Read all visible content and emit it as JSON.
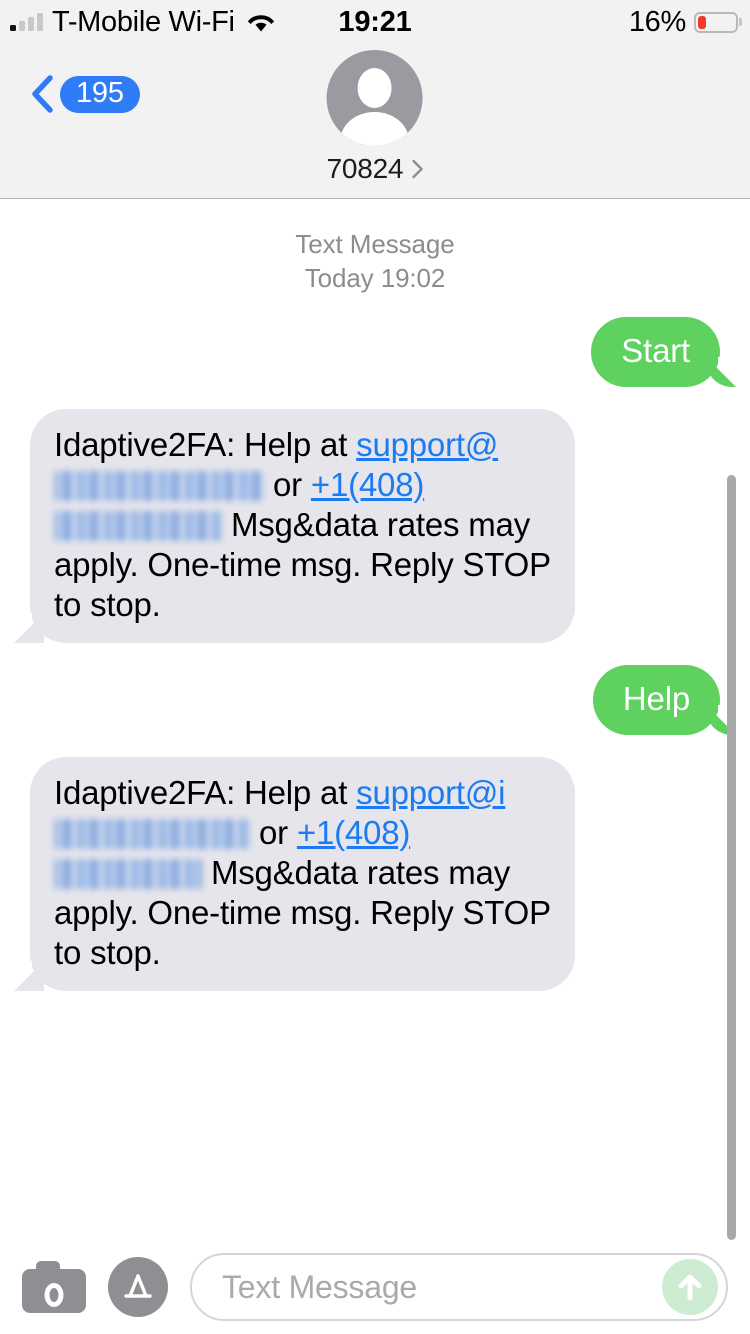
{
  "status_bar": {
    "carrier": "T-Mobile Wi-Fi",
    "time": "19:21",
    "battery_percent": "16%",
    "battery_level": 16,
    "signal_bars_filled": 1,
    "signal_bars_total": 4,
    "wifi_icon": "wifi-icon",
    "battery_icon": "battery-icon",
    "battery_color": "#f03b2d"
  },
  "nav_bar": {
    "back_badge": "195",
    "back_icon": "chevron-left-icon",
    "badge_color": "#2f7cf6",
    "contact_name": "70824",
    "contact_chevron_icon": "chevron-right-icon",
    "avatar_icon": "person-avatar-icon"
  },
  "conversation": {
    "service_label": "Text Message",
    "timestamp": "Today 19:02",
    "outgoing_color": "#5ed15e",
    "incoming_color": "#e6e5eb",
    "link_color": "#1a7bf2",
    "messages": [
      {
        "id": "msg-1",
        "direction": "outgoing",
        "text": "Start"
      },
      {
        "id": "msg-2",
        "direction": "incoming",
        "segments": {
          "lead": "Idaptive2FA: Help at ",
          "email_visible": "support@",
          "email_redacted": true,
          "between": " or ",
          "phone_visible": "+1(408)",
          "phone_redacted": true,
          "tail": " Msg&data rates may apply. One-time msg. Reply STOP to stop."
        }
      },
      {
        "id": "msg-3",
        "direction": "outgoing",
        "text": "Help"
      },
      {
        "id": "msg-4",
        "direction": "incoming",
        "segments": {
          "lead": "Idaptive2FA: Help at ",
          "email_visible": "support@i",
          "email_redacted": true,
          "between": " or ",
          "phone_visible": "+1(408)",
          "phone_redacted": true,
          "tail": " Msg&data rates may apply. One-time msg. Reply STOP to stop."
        }
      }
    ]
  },
  "input_bar": {
    "camera_icon": "camera-icon",
    "appstore_icon": "app-store-icon",
    "placeholder": "Text Message",
    "value": "",
    "send_icon": "send-arrow-up-icon",
    "send_enabled": false,
    "send_color": "#cdecd2"
  }
}
